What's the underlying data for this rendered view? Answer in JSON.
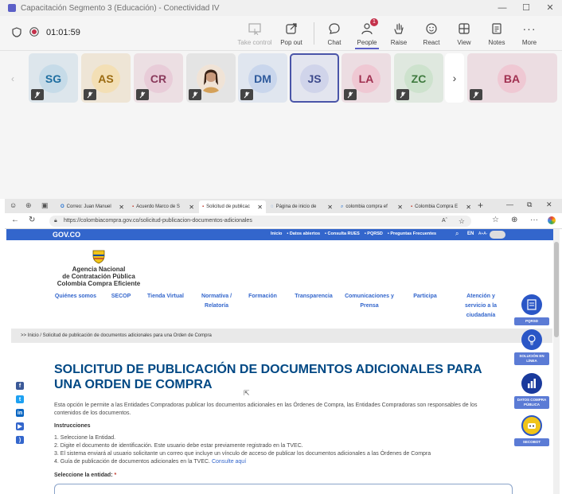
{
  "window": {
    "title": "Capacitación Segmento 3 (Educación) - Conectividad IV"
  },
  "meeting": {
    "timer": "01:01:59",
    "buttons": {
      "take_control": "Take control",
      "pop_out": "Pop out",
      "chat": "Chat",
      "people": "People",
      "raise": "Raise",
      "react": "React",
      "view": "View",
      "notes": "Notes",
      "more": "More"
    },
    "people_badge": "1",
    "participants": [
      {
        "initials": "SG",
        "color": "#1e6ea0"
      },
      {
        "initials": "AS",
        "color": "#9a6a10"
      },
      {
        "initials": "CR",
        "color": "#8a3a5c"
      },
      {
        "initials": "",
        "color": "#555555"
      },
      {
        "initials": "DM",
        "color": "#2e5a9c"
      },
      {
        "initials": "JS",
        "color": "#3d4a8c"
      },
      {
        "initials": "LA",
        "color": "#a03050"
      },
      {
        "initials": "ZC",
        "color": "#3f7a3f"
      },
      {
        "initials": "BA",
        "color": "#a03050"
      }
    ]
  },
  "browser": {
    "tabs": [
      {
        "label": "Correo: Juan Manuel"
      },
      {
        "label": "Acuerdo Marco de S"
      },
      {
        "label": "Solicitud de publicac"
      },
      {
        "label": "Página de inicio de"
      },
      {
        "label": "colombia compra ef"
      },
      {
        "label": "Colombia Compra E"
      }
    ],
    "url": "https://colombiacompra.gov.co/solicitud-publicacion-documentos-adicionales",
    "zoom_label": "Aˆ"
  },
  "site": {
    "gov_logo": "GOV.CO",
    "top_links": [
      "Inicio",
      "• Datos abiertos",
      "• Consulta RUES",
      "• PQRSD",
      "• Preguntas Frecuentes"
    ],
    "lang": "EN",
    "text_size": "A+A-",
    "agency": [
      "Agencia Nacional",
      "de Contratación Pública",
      "Colombia Compra Eficiente"
    ],
    "nav": [
      "Quiénes somos",
      "SECOP",
      "Tienda Virtual",
      "Normativa / Relatoría",
      "Formación",
      "Transparencia",
      "Comunicaciones y Prensa",
      "Participa",
      "Atención y servicio a la ciudadanía"
    ],
    "breadcrumb": ">> Inicio / Solicitud de publicación de documentos adicionales para una Orden de Compra",
    "title": "SOLICITUD DE PUBLICACIÓN DE DOCUMENTOS ADICIONALES PARA UNA ORDEN DE COMPRA",
    "intro": "Esta opción le permite a las Entidades Compradoras publicar los documentos adicionales en las Órdenes de Compra, las Entidades Compradoras son responsables de los contenidos de los documentos.",
    "instructions_title": "Instrucciones",
    "steps": [
      "1. Seleccione la Entidad.",
      "2. Digite el documento de identificación. Este usuario debe estar previamente registrado en la TVEC.",
      "3. El sistema enviará al usuario solicitante un correo que incluye un vínculo de acceso de publicar los documentos adicionales a las Órdenes de Compra",
      "4. Guía de publicación de documentos adicionales en la TVEC."
    ],
    "consult_link": "Consulte aquí",
    "entity_label": "Seleccione la entidad:",
    "required_mark": "*",
    "side_buttons": [
      "PQRSD",
      "SOLUCIÓN EN LÍNEA",
      "DATOS COMPRA PÚBLICA",
      "SECOBOT"
    ]
  }
}
